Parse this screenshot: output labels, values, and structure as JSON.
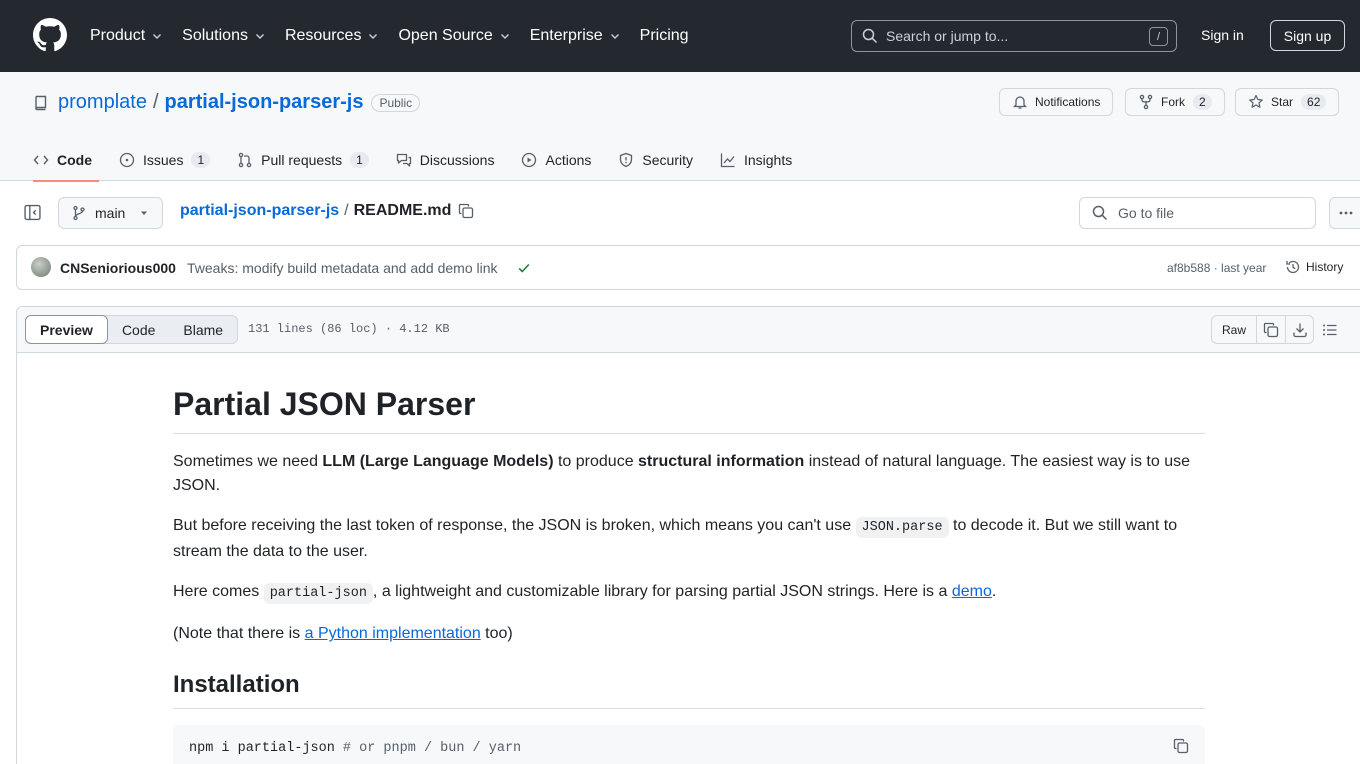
{
  "global_nav": {
    "items": [
      {
        "label": "Product",
        "dropdown": true
      },
      {
        "label": "Solutions",
        "dropdown": true
      },
      {
        "label": "Resources",
        "dropdown": true
      },
      {
        "label": "Open Source",
        "dropdown": true
      },
      {
        "label": "Enterprise",
        "dropdown": true
      },
      {
        "label": "Pricing",
        "dropdown": false
      }
    ],
    "search_placeholder": "Search or jump to...",
    "search_shortcut": "/",
    "sign_in": "Sign in",
    "sign_up": "Sign up"
  },
  "repo": {
    "owner": "promplate",
    "separator": "/",
    "name": "partial-json-parser-js",
    "visibility": "Public",
    "notifications_label": "Notifications",
    "fork_label": "Fork",
    "fork_count": "2",
    "star_label": "Star",
    "star_count": "62"
  },
  "tabs": [
    {
      "label": "Code",
      "active": true,
      "icon": "code-icon"
    },
    {
      "label": "Issues",
      "count": "1",
      "icon": "issue-icon"
    },
    {
      "label": "Pull requests",
      "count": "1",
      "icon": "pull-request-icon"
    },
    {
      "label": "Discussions",
      "icon": "discussions-icon"
    },
    {
      "label": "Actions",
      "icon": "play-icon"
    },
    {
      "label": "Security",
      "icon": "shield-icon"
    },
    {
      "label": "Insights",
      "icon": "graph-icon"
    }
  ],
  "file_nav": {
    "branch": "main",
    "crumb_repo": "partial-json-parser-js",
    "crumb_sep": "/",
    "crumb_file": "README.md",
    "goto_placeholder": "Go to file"
  },
  "commit": {
    "author": "CNSeniorious000",
    "message": "Tweaks: modify build metadata and add demo link",
    "sha_time": "af8b588 · last year",
    "history": "History"
  },
  "file_header": {
    "views": [
      "Preview",
      "Code",
      "Blame"
    ],
    "meta": "131 lines (86 loc) · 4.12 KB",
    "raw": "Raw"
  },
  "readme": {
    "title": "Partial JSON Parser",
    "p1": {
      "a": "Sometimes we need ",
      "b1": "LLM (Large Language Models)",
      "c": " to produce ",
      "b2": "structural information",
      "d": " instead of natural language. The easiest way is to use JSON."
    },
    "p2": {
      "a": "But before receiving the last token of response, the JSON is broken, which means you can't use ",
      "code": "JSON.parse",
      "b": " to decode it. But we still want to stream the data to the user."
    },
    "p3": {
      "a": "Here comes ",
      "code": "partial-json",
      "b": ", a lightweight and customizable library for parsing partial JSON strings. Here is a ",
      "link": "demo",
      "c": "."
    },
    "p4": {
      "a": "(Note that there is ",
      "link": "a Python implementation",
      "b": " too)"
    },
    "h2": "Installation",
    "code_cmd": "npm i partial-json",
    "code_comment": " # or pnpm / bun / yarn"
  },
  "colors": {
    "header_bg": "#24292f",
    "link": "#0969da",
    "active_tab_underline": "#fd8c73",
    "success": "#1a7f37"
  }
}
